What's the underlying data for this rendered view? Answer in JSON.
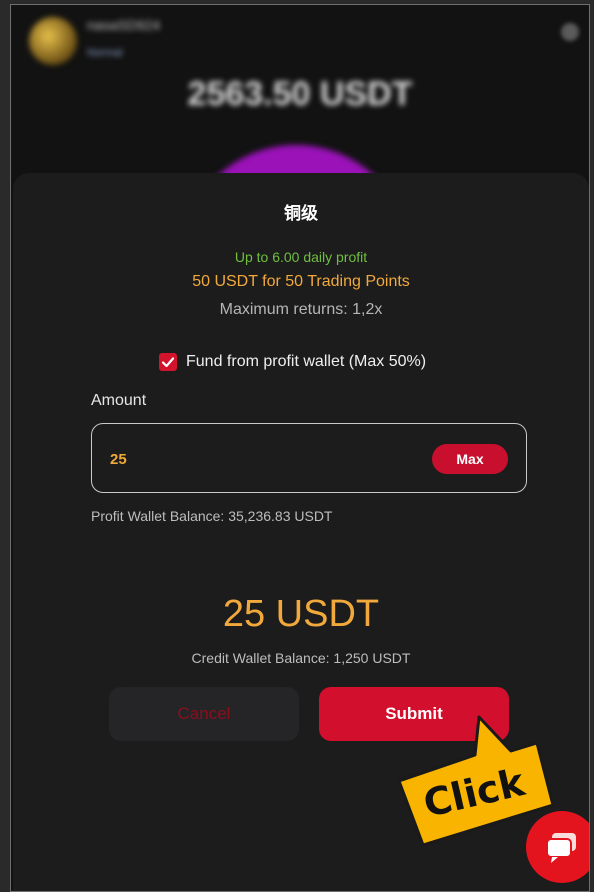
{
  "background": {
    "username": "nasaSD924",
    "badge": "Normal",
    "balance": "2563.50 USDT"
  },
  "modal": {
    "title": "铜级",
    "daily_profit": "Up to 6.00 daily profit",
    "trading_points": "50 USDT for 50 Trading Points",
    "max_returns": "Maximum returns: 1,2x",
    "fund_checkbox_checked": true,
    "fund_label": "Fund from profit wallet (Max 50%)",
    "amount_label": "Amount",
    "amount_value": "25",
    "max_label": "Max",
    "profit_wallet_balance": "Profit Wallet Balance: 35,236.83 USDT",
    "total_amount": "25 USDT",
    "credit_wallet_balance": "Credit Wallet Balance: 1,250 USDT",
    "cancel_label": "Cancel",
    "submit_label": "Submit"
  },
  "annotation": {
    "click_label": "Click"
  },
  "colors": {
    "accent_red": "#d20f2c",
    "gold": "#f2a93b",
    "green": "#6fbf3f",
    "callout_yellow": "#f9b400"
  },
  "icons": {
    "checkbox": "check-icon",
    "chat": "chat-bubble-icon",
    "settings": "gear-icon"
  }
}
